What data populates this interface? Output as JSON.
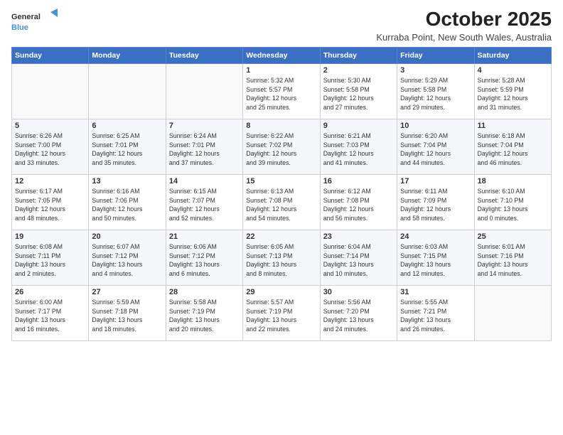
{
  "logo": {
    "line1": "General",
    "line2": "Blue"
  },
  "title": "October 2025",
  "subtitle": "Kurraba Point, New South Wales, Australia",
  "days_of_week": [
    "Sunday",
    "Monday",
    "Tuesday",
    "Wednesday",
    "Thursday",
    "Friday",
    "Saturday"
  ],
  "weeks": [
    [
      {
        "num": "",
        "info": ""
      },
      {
        "num": "",
        "info": ""
      },
      {
        "num": "",
        "info": ""
      },
      {
        "num": "1",
        "info": "Sunrise: 5:32 AM\nSunset: 5:57 PM\nDaylight: 12 hours\nand 25 minutes."
      },
      {
        "num": "2",
        "info": "Sunrise: 5:30 AM\nSunset: 5:58 PM\nDaylight: 12 hours\nand 27 minutes."
      },
      {
        "num": "3",
        "info": "Sunrise: 5:29 AM\nSunset: 5:58 PM\nDaylight: 12 hours\nand 29 minutes."
      },
      {
        "num": "4",
        "info": "Sunrise: 5:28 AM\nSunset: 5:59 PM\nDaylight: 12 hours\nand 31 minutes."
      }
    ],
    [
      {
        "num": "5",
        "info": "Sunrise: 6:26 AM\nSunset: 7:00 PM\nDaylight: 12 hours\nand 33 minutes."
      },
      {
        "num": "6",
        "info": "Sunrise: 6:25 AM\nSunset: 7:01 PM\nDaylight: 12 hours\nand 35 minutes."
      },
      {
        "num": "7",
        "info": "Sunrise: 6:24 AM\nSunset: 7:01 PM\nDaylight: 12 hours\nand 37 minutes."
      },
      {
        "num": "8",
        "info": "Sunrise: 6:22 AM\nSunset: 7:02 PM\nDaylight: 12 hours\nand 39 minutes."
      },
      {
        "num": "9",
        "info": "Sunrise: 6:21 AM\nSunset: 7:03 PM\nDaylight: 12 hours\nand 41 minutes."
      },
      {
        "num": "10",
        "info": "Sunrise: 6:20 AM\nSunset: 7:04 PM\nDaylight: 12 hours\nand 44 minutes."
      },
      {
        "num": "11",
        "info": "Sunrise: 6:18 AM\nSunset: 7:04 PM\nDaylight: 12 hours\nand 46 minutes."
      }
    ],
    [
      {
        "num": "12",
        "info": "Sunrise: 6:17 AM\nSunset: 7:05 PM\nDaylight: 12 hours\nand 48 minutes."
      },
      {
        "num": "13",
        "info": "Sunrise: 6:16 AM\nSunset: 7:06 PM\nDaylight: 12 hours\nand 50 minutes."
      },
      {
        "num": "14",
        "info": "Sunrise: 6:15 AM\nSunset: 7:07 PM\nDaylight: 12 hours\nand 52 minutes."
      },
      {
        "num": "15",
        "info": "Sunrise: 6:13 AM\nSunset: 7:08 PM\nDaylight: 12 hours\nand 54 minutes."
      },
      {
        "num": "16",
        "info": "Sunrise: 6:12 AM\nSunset: 7:08 PM\nDaylight: 12 hours\nand 56 minutes."
      },
      {
        "num": "17",
        "info": "Sunrise: 6:11 AM\nSunset: 7:09 PM\nDaylight: 12 hours\nand 58 minutes."
      },
      {
        "num": "18",
        "info": "Sunrise: 6:10 AM\nSunset: 7:10 PM\nDaylight: 13 hours\nand 0 minutes."
      }
    ],
    [
      {
        "num": "19",
        "info": "Sunrise: 6:08 AM\nSunset: 7:11 PM\nDaylight: 13 hours\nand 2 minutes."
      },
      {
        "num": "20",
        "info": "Sunrise: 6:07 AM\nSunset: 7:12 PM\nDaylight: 13 hours\nand 4 minutes."
      },
      {
        "num": "21",
        "info": "Sunrise: 6:06 AM\nSunset: 7:12 PM\nDaylight: 13 hours\nand 6 minutes."
      },
      {
        "num": "22",
        "info": "Sunrise: 6:05 AM\nSunset: 7:13 PM\nDaylight: 13 hours\nand 8 minutes."
      },
      {
        "num": "23",
        "info": "Sunrise: 6:04 AM\nSunset: 7:14 PM\nDaylight: 13 hours\nand 10 minutes."
      },
      {
        "num": "24",
        "info": "Sunrise: 6:03 AM\nSunset: 7:15 PM\nDaylight: 13 hours\nand 12 minutes."
      },
      {
        "num": "25",
        "info": "Sunrise: 6:01 AM\nSunset: 7:16 PM\nDaylight: 13 hours\nand 14 minutes."
      }
    ],
    [
      {
        "num": "26",
        "info": "Sunrise: 6:00 AM\nSunset: 7:17 PM\nDaylight: 13 hours\nand 16 minutes."
      },
      {
        "num": "27",
        "info": "Sunrise: 5:59 AM\nSunset: 7:18 PM\nDaylight: 13 hours\nand 18 minutes."
      },
      {
        "num": "28",
        "info": "Sunrise: 5:58 AM\nSunset: 7:19 PM\nDaylight: 13 hours\nand 20 minutes."
      },
      {
        "num": "29",
        "info": "Sunrise: 5:57 AM\nSunset: 7:19 PM\nDaylight: 13 hours\nand 22 minutes."
      },
      {
        "num": "30",
        "info": "Sunrise: 5:56 AM\nSunset: 7:20 PM\nDaylight: 13 hours\nand 24 minutes."
      },
      {
        "num": "31",
        "info": "Sunrise: 5:55 AM\nSunset: 7:21 PM\nDaylight: 13 hours\nand 26 minutes."
      },
      {
        "num": "",
        "info": ""
      }
    ]
  ]
}
